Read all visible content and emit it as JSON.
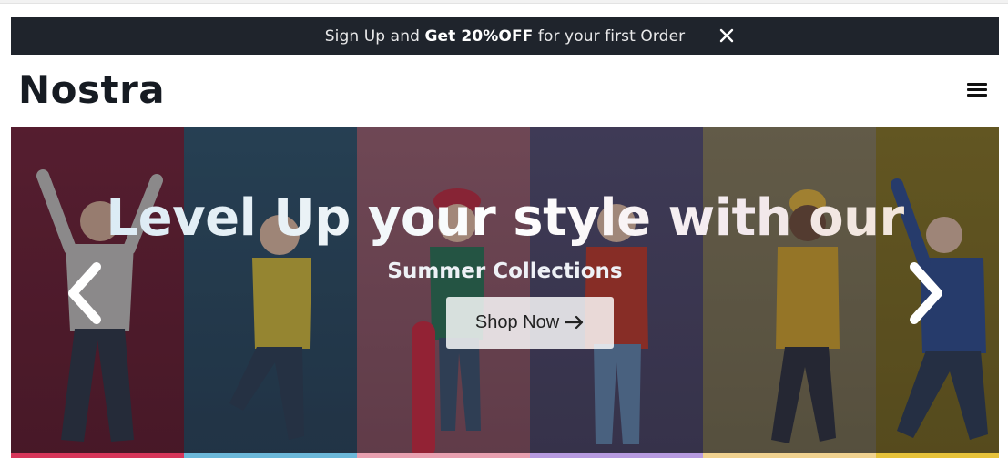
{
  "promo": {
    "text_before": "Sign Up and ",
    "text_strong": "Get 20%OFF",
    "text_after": " for your first Order",
    "close_icon": "close-icon"
  },
  "header": {
    "logo": "Nostra",
    "menu_icon": "hamburger-menu-icon"
  },
  "hero": {
    "title": "Level Up your style with our",
    "subtitle": "Summer Collections",
    "button_label": "Shop Now",
    "button_icon": "arrow-right-icon",
    "prev_icon": "chevron-left-icon",
    "next_icon": "chevron-right-icon",
    "panel_colors": [
      "#6d1f35",
      "#2a4b63",
      "#8a5464",
      "#4d4668",
      "#7c7157",
      "#7e6d22"
    ],
    "strip_colors": [
      "#d6365a",
      "#6cb8d9",
      "#e8a0b0",
      "#b79be0",
      "#f0d290",
      "#e6c23a"
    ]
  }
}
